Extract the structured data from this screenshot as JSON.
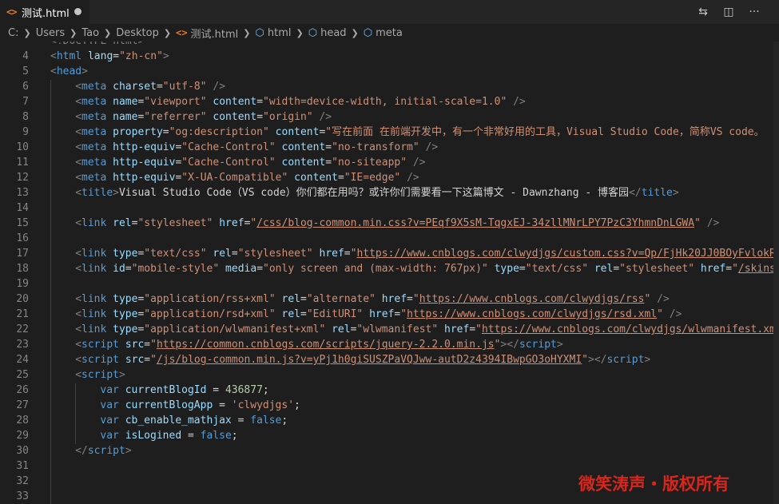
{
  "tab": {
    "icon": "html-file-icon",
    "icon_glyph": "<>",
    "label": "测试.html",
    "modified_dot": "unsaved-dot"
  },
  "title_actions": [
    {
      "name": "compare-changes-icon",
      "glyph": "⇆"
    },
    {
      "name": "split-editor-icon",
      "glyph": "◫"
    },
    {
      "name": "more-actions-icon",
      "glyph": "···"
    }
  ],
  "breadcrumb": [
    "C:",
    "Users",
    "Tao",
    "Desktop",
    "测试.html",
    "html",
    "head",
    "meta"
  ],
  "editor": {
    "lines": [
      {
        "n": "",
        "indent": 0,
        "parts": [
          [
            "p",
            "<!DOCTYPE html>"
          ]
        ]
      },
      {
        "n": "4",
        "indent": 0,
        "parts": [
          [
            "p",
            "<"
          ],
          [
            "t",
            "html"
          ],
          [
            "w",
            " "
          ],
          [
            "a",
            "lang"
          ],
          [
            "w",
            "="
          ],
          [
            "s",
            "\"zh-cn\""
          ],
          [
            "p",
            ">"
          ]
        ]
      },
      {
        "n": "5",
        "indent": 0,
        "parts": [
          [
            "p",
            "<"
          ],
          [
            "t",
            "head"
          ],
          [
            "p",
            ">"
          ]
        ]
      },
      {
        "n": "6",
        "indent": 2,
        "parts": [
          [
            "p",
            "<"
          ],
          [
            "t",
            "meta"
          ],
          [
            "w",
            " "
          ],
          [
            "a",
            "charset"
          ],
          [
            "w",
            "="
          ],
          [
            "s",
            "\"utf-8\""
          ],
          [
            "w",
            " "
          ],
          [
            "p",
            "/>"
          ]
        ]
      },
      {
        "n": "7",
        "indent": 2,
        "parts": [
          [
            "p",
            "<"
          ],
          [
            "t",
            "meta"
          ],
          [
            "w",
            " "
          ],
          [
            "a",
            "name"
          ],
          [
            "w",
            "="
          ],
          [
            "s",
            "\"viewport\""
          ],
          [
            "w",
            " "
          ],
          [
            "a",
            "content"
          ],
          [
            "w",
            "="
          ],
          [
            "s",
            "\"width=device-width, initial-scale=1.0\""
          ],
          [
            "w",
            " "
          ],
          [
            "p",
            "/>"
          ]
        ]
      },
      {
        "n": "8",
        "indent": 2,
        "parts": [
          [
            "p",
            "<"
          ],
          [
            "t",
            "meta"
          ],
          [
            "w",
            " "
          ],
          [
            "a",
            "name"
          ],
          [
            "w",
            "="
          ],
          [
            "s",
            "\"referrer\""
          ],
          [
            "w",
            " "
          ],
          [
            "a",
            "content"
          ],
          [
            "w",
            "="
          ],
          [
            "s",
            "\"origin\""
          ],
          [
            "w",
            " "
          ],
          [
            "p",
            "/>"
          ]
        ]
      },
      {
        "n": "9",
        "indent": 2,
        "parts": [
          [
            "p",
            "<"
          ],
          [
            "t",
            "meta"
          ],
          [
            "w",
            " "
          ],
          [
            "a",
            "property"
          ],
          [
            "w",
            "="
          ],
          [
            "s",
            "\"og:description\""
          ],
          [
            "w",
            " "
          ],
          [
            "a",
            "content"
          ],
          [
            "w",
            "="
          ],
          [
            "s",
            "\"写在前面 在前端开发中，有一个非常好用的工具，Visual Studio Code，简称VS code。"
          ]
        ]
      },
      {
        "n": "10",
        "indent": 2,
        "parts": [
          [
            "p",
            "<"
          ],
          [
            "t",
            "meta"
          ],
          [
            "w",
            " "
          ],
          [
            "a",
            "http-equiv"
          ],
          [
            "w",
            "="
          ],
          [
            "s",
            "\"Cache-Control\""
          ],
          [
            "w",
            " "
          ],
          [
            "a",
            "content"
          ],
          [
            "w",
            "="
          ],
          [
            "s",
            "\"no-transform\""
          ],
          [
            "w",
            " "
          ],
          [
            "p",
            "/>"
          ]
        ]
      },
      {
        "n": "11",
        "indent": 2,
        "parts": [
          [
            "p",
            "<"
          ],
          [
            "t",
            "meta"
          ],
          [
            "w",
            " "
          ],
          [
            "a",
            "http-equiv"
          ],
          [
            "w",
            "="
          ],
          [
            "s",
            "\"Cache-Control\""
          ],
          [
            "w",
            " "
          ],
          [
            "a",
            "content"
          ],
          [
            "w",
            "="
          ],
          [
            "s",
            "\"no-siteapp\""
          ],
          [
            "w",
            " "
          ],
          [
            "p",
            "/>"
          ]
        ]
      },
      {
        "n": "12",
        "indent": 2,
        "parts": [
          [
            "p",
            "<"
          ],
          [
            "t",
            "meta"
          ],
          [
            "w",
            " "
          ],
          [
            "a",
            "http-equiv"
          ],
          [
            "w",
            "="
          ],
          [
            "s",
            "\"X-UA-Compatible\""
          ],
          [
            "w",
            " "
          ],
          [
            "a",
            "content"
          ],
          [
            "w",
            "="
          ],
          [
            "s",
            "\"IE=edge\""
          ],
          [
            "w",
            " "
          ],
          [
            "p",
            "/>"
          ]
        ]
      },
      {
        "n": "13",
        "indent": 2,
        "parts": [
          [
            "p",
            "<"
          ],
          [
            "t",
            "title"
          ],
          [
            "p",
            ">"
          ],
          [
            "w",
            "Visual Studio Code（VS code）你们都在用吗？或许你们需要看一下这篇博文 - Dawnzhang - 博客园"
          ],
          [
            "p",
            "</"
          ],
          [
            "t",
            "title"
          ],
          [
            "p",
            ">"
          ]
        ]
      },
      {
        "n": "14",
        "indent": 0,
        "parts": []
      },
      {
        "n": "15",
        "indent": 2,
        "parts": [
          [
            "p",
            "<"
          ],
          [
            "t",
            "link"
          ],
          [
            "w",
            " "
          ],
          [
            "a",
            "rel"
          ],
          [
            "w",
            "="
          ],
          [
            "s",
            "\"stylesheet\""
          ],
          [
            "w",
            " "
          ],
          [
            "a",
            "href"
          ],
          [
            "w",
            "="
          ],
          [
            "s",
            "\""
          ],
          [
            "u",
            "/css/blog-common.min.css?v=PEqf9X5sM-TqgxEJ-34zllMNrLPY7PzC3YhmnDnLGWA"
          ],
          [
            "s",
            "\""
          ],
          [
            "w",
            " "
          ],
          [
            "p",
            "/>"
          ]
        ]
      },
      {
        "n": "16",
        "indent": 0,
        "parts": []
      },
      {
        "n": "17",
        "indent": 2,
        "parts": [
          [
            "p",
            "<"
          ],
          [
            "t",
            "link"
          ],
          [
            "w",
            " "
          ],
          [
            "a",
            "type"
          ],
          [
            "w",
            "="
          ],
          [
            "s",
            "\"text/css\""
          ],
          [
            "w",
            " "
          ],
          [
            "a",
            "rel"
          ],
          [
            "w",
            "="
          ],
          [
            "s",
            "\"stylesheet\""
          ],
          [
            "w",
            " "
          ],
          [
            "a",
            "href"
          ],
          [
            "w",
            "="
          ],
          [
            "s",
            "\""
          ],
          [
            "u",
            "https://www.cnblogs.com/clwydjgs/custom.css?v=Qp/FjHk20JJ0BOyFvlokRG6"
          ]
        ]
      },
      {
        "n": "18",
        "indent": 2,
        "parts": [
          [
            "p",
            "<"
          ],
          [
            "t",
            "link"
          ],
          [
            "w",
            " "
          ],
          [
            "a",
            "id"
          ],
          [
            "w",
            "="
          ],
          [
            "s",
            "\"mobile-style\""
          ],
          [
            "w",
            " "
          ],
          [
            "a",
            "media"
          ],
          [
            "w",
            "="
          ],
          [
            "s",
            "\"only screen and (max-width: 767px)\""
          ],
          [
            "w",
            " "
          ],
          [
            "a",
            "type"
          ],
          [
            "w",
            "="
          ],
          [
            "s",
            "\"text/css\""
          ],
          [
            "w",
            " "
          ],
          [
            "a",
            "rel"
          ],
          [
            "w",
            "="
          ],
          [
            "s",
            "\"stylesheet\""
          ],
          [
            "w",
            " "
          ],
          [
            "a",
            "href"
          ],
          [
            "w",
            "="
          ],
          [
            "s",
            "\""
          ],
          [
            "u",
            "/skins/b"
          ]
        ]
      },
      {
        "n": "19",
        "indent": 0,
        "parts": []
      },
      {
        "n": "20",
        "indent": 2,
        "parts": [
          [
            "p",
            "<"
          ],
          [
            "t",
            "link"
          ],
          [
            "w",
            " "
          ],
          [
            "a",
            "type"
          ],
          [
            "w",
            "="
          ],
          [
            "s",
            "\"application/rss+xml\""
          ],
          [
            "w",
            " "
          ],
          [
            "a",
            "rel"
          ],
          [
            "w",
            "="
          ],
          [
            "s",
            "\"alternate\""
          ],
          [
            "w",
            " "
          ],
          [
            "a",
            "href"
          ],
          [
            "w",
            "="
          ],
          [
            "s",
            "\""
          ],
          [
            "u",
            "https://www.cnblogs.com/clwydjgs/rss"
          ],
          [
            "s",
            "\""
          ],
          [
            "w",
            " "
          ],
          [
            "p",
            "/>"
          ]
        ]
      },
      {
        "n": "21",
        "indent": 2,
        "parts": [
          [
            "p",
            "<"
          ],
          [
            "t",
            "link"
          ],
          [
            "w",
            " "
          ],
          [
            "a",
            "type"
          ],
          [
            "w",
            "="
          ],
          [
            "s",
            "\"application/rsd+xml\""
          ],
          [
            "w",
            " "
          ],
          [
            "a",
            "rel"
          ],
          [
            "w",
            "="
          ],
          [
            "s",
            "\"EditURI\""
          ],
          [
            "w",
            " "
          ],
          [
            "a",
            "href"
          ],
          [
            "w",
            "="
          ],
          [
            "s",
            "\""
          ],
          [
            "u",
            "https://www.cnblogs.com/clwydjgs/rsd.xml"
          ],
          [
            "s",
            "\""
          ],
          [
            "w",
            " "
          ],
          [
            "p",
            "/>"
          ]
        ]
      },
      {
        "n": "22",
        "indent": 2,
        "parts": [
          [
            "p",
            "<"
          ],
          [
            "t",
            "link"
          ],
          [
            "w",
            " "
          ],
          [
            "a",
            "type"
          ],
          [
            "w",
            "="
          ],
          [
            "s",
            "\"application/wlwmanifest+xml\""
          ],
          [
            "w",
            " "
          ],
          [
            "a",
            "rel"
          ],
          [
            "w",
            "="
          ],
          [
            "s",
            "\"wlwmanifest\""
          ],
          [
            "w",
            " "
          ],
          [
            "a",
            "href"
          ],
          [
            "w",
            "="
          ],
          [
            "s",
            "\""
          ],
          [
            "u",
            "https://www.cnblogs.com/clwydjgs/wlwmanifest.xml"
          ],
          [
            "s",
            "\""
          ]
        ]
      },
      {
        "n": "23",
        "indent": 2,
        "parts": [
          [
            "p",
            "<"
          ],
          [
            "t",
            "script"
          ],
          [
            "w",
            " "
          ],
          [
            "a",
            "src"
          ],
          [
            "w",
            "="
          ],
          [
            "s",
            "\""
          ],
          [
            "u",
            "https://common.cnblogs.com/scripts/jquery-2.2.0.min.js"
          ],
          [
            "s",
            "\""
          ],
          [
            "p",
            "></"
          ],
          [
            "t",
            "script"
          ],
          [
            "p",
            ">"
          ]
        ]
      },
      {
        "n": "24",
        "indent": 2,
        "parts": [
          [
            "p",
            "<"
          ],
          [
            "t",
            "script"
          ],
          [
            "w",
            " "
          ],
          [
            "a",
            "src"
          ],
          [
            "w",
            "="
          ],
          [
            "s",
            "\""
          ],
          [
            "u",
            "/js/blog-common.min.js?v=yPj1h0giSUSZPaVQJww-autD2z4394IBwpGO3oHYXMI"
          ],
          [
            "s",
            "\""
          ],
          [
            "p",
            "></"
          ],
          [
            "t",
            "script"
          ],
          [
            "p",
            ">"
          ]
        ]
      },
      {
        "n": "25",
        "indent": 2,
        "parts": [
          [
            "p",
            "<"
          ],
          [
            "t",
            "script"
          ],
          [
            "p",
            ">"
          ]
        ]
      },
      {
        "n": "26",
        "indent": 4,
        "parts": [
          [
            "k",
            "var"
          ],
          [
            "w",
            " "
          ],
          [
            "a",
            "currentBlogId"
          ],
          [
            "w",
            " = "
          ],
          [
            "n",
            "436877"
          ],
          [
            "w",
            ";"
          ]
        ]
      },
      {
        "n": "27",
        "indent": 4,
        "parts": [
          [
            "k",
            "var"
          ],
          [
            "w",
            " "
          ],
          [
            "a",
            "currentBlogApp"
          ],
          [
            "w",
            " = "
          ],
          [
            "s",
            "'clwydjgs'"
          ],
          [
            "w",
            ";"
          ]
        ]
      },
      {
        "n": "28",
        "indent": 4,
        "parts": [
          [
            "k",
            "var"
          ],
          [
            "w",
            " "
          ],
          [
            "a",
            "cb_enable_mathjax"
          ],
          [
            "w",
            " = "
          ],
          [
            "k",
            "false"
          ],
          [
            "w",
            ";"
          ]
        ]
      },
      {
        "n": "29",
        "indent": 4,
        "parts": [
          [
            "k",
            "var"
          ],
          [
            "w",
            " "
          ],
          [
            "a",
            "isLogined"
          ],
          [
            "w",
            " = "
          ],
          [
            "k",
            "false"
          ],
          [
            "w",
            ";"
          ]
        ]
      },
      {
        "n": "30",
        "indent": 2,
        "parts": [
          [
            "p",
            "</"
          ],
          [
            "t",
            "script"
          ],
          [
            "p",
            ">"
          ]
        ]
      },
      {
        "n": "31",
        "indent": 0,
        "parts": []
      },
      {
        "n": "32",
        "indent": 0,
        "parts": []
      },
      {
        "n": "33",
        "indent": 0,
        "parts": []
      }
    ]
  },
  "watermark": "微笑涛声・版权所有"
}
